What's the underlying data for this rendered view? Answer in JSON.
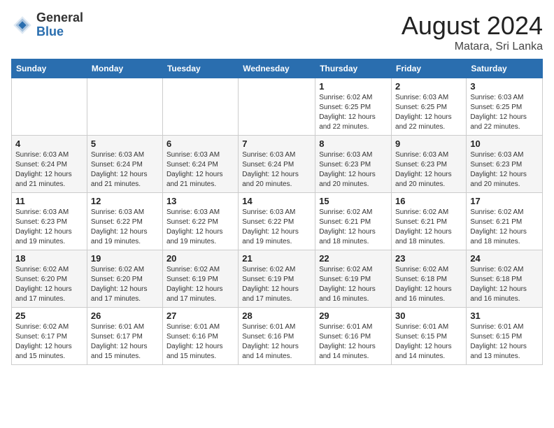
{
  "header": {
    "logo_general": "General",
    "logo_blue": "Blue",
    "month_year": "August 2024",
    "location": "Matara, Sri Lanka"
  },
  "weekdays": [
    "Sunday",
    "Monday",
    "Tuesday",
    "Wednesday",
    "Thursday",
    "Friday",
    "Saturday"
  ],
  "weeks": [
    [
      {
        "day": "",
        "info": ""
      },
      {
        "day": "",
        "info": ""
      },
      {
        "day": "",
        "info": ""
      },
      {
        "day": "",
        "info": ""
      },
      {
        "day": "1",
        "info": "Sunrise: 6:02 AM\nSunset: 6:25 PM\nDaylight: 12 hours and 22 minutes."
      },
      {
        "day": "2",
        "info": "Sunrise: 6:03 AM\nSunset: 6:25 PM\nDaylight: 12 hours and 22 minutes."
      },
      {
        "day": "3",
        "info": "Sunrise: 6:03 AM\nSunset: 6:25 PM\nDaylight: 12 hours and 22 minutes."
      }
    ],
    [
      {
        "day": "4",
        "info": "Sunrise: 6:03 AM\nSunset: 6:24 PM\nDaylight: 12 hours and 21 minutes."
      },
      {
        "day": "5",
        "info": "Sunrise: 6:03 AM\nSunset: 6:24 PM\nDaylight: 12 hours and 21 minutes."
      },
      {
        "day": "6",
        "info": "Sunrise: 6:03 AM\nSunset: 6:24 PM\nDaylight: 12 hours and 21 minutes."
      },
      {
        "day": "7",
        "info": "Sunrise: 6:03 AM\nSunset: 6:24 PM\nDaylight: 12 hours and 20 minutes."
      },
      {
        "day": "8",
        "info": "Sunrise: 6:03 AM\nSunset: 6:23 PM\nDaylight: 12 hours and 20 minutes."
      },
      {
        "day": "9",
        "info": "Sunrise: 6:03 AM\nSunset: 6:23 PM\nDaylight: 12 hours and 20 minutes."
      },
      {
        "day": "10",
        "info": "Sunrise: 6:03 AM\nSunset: 6:23 PM\nDaylight: 12 hours and 20 minutes."
      }
    ],
    [
      {
        "day": "11",
        "info": "Sunrise: 6:03 AM\nSunset: 6:23 PM\nDaylight: 12 hours and 19 minutes."
      },
      {
        "day": "12",
        "info": "Sunrise: 6:03 AM\nSunset: 6:22 PM\nDaylight: 12 hours and 19 minutes."
      },
      {
        "day": "13",
        "info": "Sunrise: 6:03 AM\nSunset: 6:22 PM\nDaylight: 12 hours and 19 minutes."
      },
      {
        "day": "14",
        "info": "Sunrise: 6:03 AM\nSunset: 6:22 PM\nDaylight: 12 hours and 19 minutes."
      },
      {
        "day": "15",
        "info": "Sunrise: 6:02 AM\nSunset: 6:21 PM\nDaylight: 12 hours and 18 minutes."
      },
      {
        "day": "16",
        "info": "Sunrise: 6:02 AM\nSunset: 6:21 PM\nDaylight: 12 hours and 18 minutes."
      },
      {
        "day": "17",
        "info": "Sunrise: 6:02 AM\nSunset: 6:21 PM\nDaylight: 12 hours and 18 minutes."
      }
    ],
    [
      {
        "day": "18",
        "info": "Sunrise: 6:02 AM\nSunset: 6:20 PM\nDaylight: 12 hours and 17 minutes."
      },
      {
        "day": "19",
        "info": "Sunrise: 6:02 AM\nSunset: 6:20 PM\nDaylight: 12 hours and 17 minutes."
      },
      {
        "day": "20",
        "info": "Sunrise: 6:02 AM\nSunset: 6:19 PM\nDaylight: 12 hours and 17 minutes."
      },
      {
        "day": "21",
        "info": "Sunrise: 6:02 AM\nSunset: 6:19 PM\nDaylight: 12 hours and 17 minutes."
      },
      {
        "day": "22",
        "info": "Sunrise: 6:02 AM\nSunset: 6:19 PM\nDaylight: 12 hours and 16 minutes."
      },
      {
        "day": "23",
        "info": "Sunrise: 6:02 AM\nSunset: 6:18 PM\nDaylight: 12 hours and 16 minutes."
      },
      {
        "day": "24",
        "info": "Sunrise: 6:02 AM\nSunset: 6:18 PM\nDaylight: 12 hours and 16 minutes."
      }
    ],
    [
      {
        "day": "25",
        "info": "Sunrise: 6:02 AM\nSunset: 6:17 PM\nDaylight: 12 hours and 15 minutes."
      },
      {
        "day": "26",
        "info": "Sunrise: 6:01 AM\nSunset: 6:17 PM\nDaylight: 12 hours and 15 minutes."
      },
      {
        "day": "27",
        "info": "Sunrise: 6:01 AM\nSunset: 6:16 PM\nDaylight: 12 hours and 15 minutes."
      },
      {
        "day": "28",
        "info": "Sunrise: 6:01 AM\nSunset: 6:16 PM\nDaylight: 12 hours and 14 minutes."
      },
      {
        "day": "29",
        "info": "Sunrise: 6:01 AM\nSunset: 6:16 PM\nDaylight: 12 hours and 14 minutes."
      },
      {
        "day": "30",
        "info": "Sunrise: 6:01 AM\nSunset: 6:15 PM\nDaylight: 12 hours and 14 minutes."
      },
      {
        "day": "31",
        "info": "Sunrise: 6:01 AM\nSunset: 6:15 PM\nDaylight: 12 hours and 13 minutes."
      }
    ]
  ]
}
